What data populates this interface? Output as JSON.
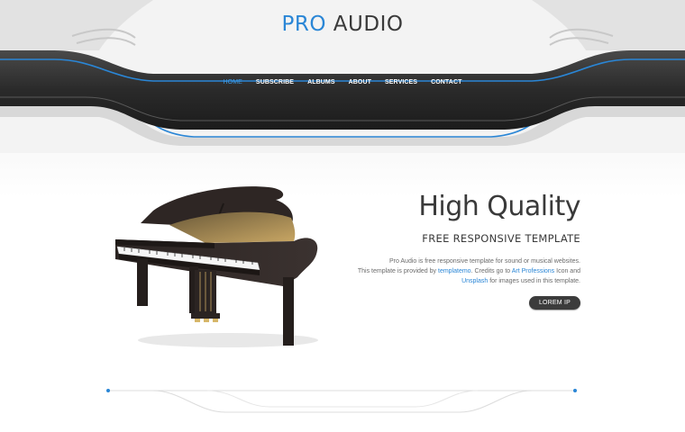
{
  "logo": {
    "accent": "PRO",
    "rest": "AUDIO"
  },
  "nav": {
    "home": "HOME",
    "subscribe": "SUBSCRIBE",
    "albums": "ALBUMS",
    "about": "ABOUT",
    "services": "SERVICES",
    "contact": "CONTACT"
  },
  "hero": {
    "title": "High Quality",
    "subtitle": "FREE RESPONSIVE TEMPLATE",
    "line1": "Pro Audio is free responsive template for sound or musical websites.",
    "line2_pre": "This template is provided by ",
    "line2_link1": "templatemo",
    "line2_mid": ". Credits go to ",
    "line2_link2": "Art Professions",
    "line2_post": " Icon and",
    "line3_link": "Unsplash",
    "line3_post": " for images used in this template.",
    "button": "LOREM IP"
  },
  "colors": {
    "accent": "#2a86d6",
    "dark_band": "#2c2c2c",
    "button": "#3c3c3c"
  },
  "icons": {
    "hero_image": "grand-piano"
  }
}
